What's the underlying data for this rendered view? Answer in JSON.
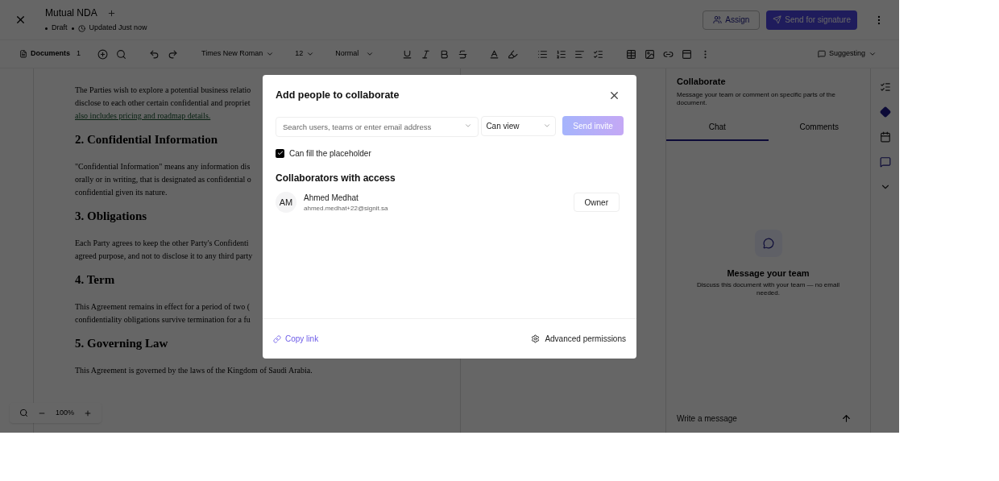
{
  "header": {
    "title": "Mutual NDA",
    "status": "Draft",
    "updated": "Updated Just now",
    "actions": [
      {
        "label": "Assign",
        "kind": "outline"
      },
      {
        "label": "Send for signature",
        "kind": "primary"
      }
    ]
  },
  "toolbar": {
    "documents": {
      "label": "Documents",
      "count": "1"
    },
    "font": "Times New Roman",
    "size": "12",
    "style": "Normal",
    "mode": "Suggesting"
  },
  "document": {
    "blocks": [
      {
        "kind": "paragraph",
        "lines": [
          {
            "text": "The Parties wish to explore a potential business relatio",
            "link": false
          },
          {
            "text": "disclose to each other certain confidential and propriet",
            "link": false
          },
          {
            "text": "also includes pricing and roadmap details.",
            "link": true
          }
        ]
      },
      {
        "kind": "heading",
        "text": "2. Confidential Information"
      },
      {
        "kind": "paragraph",
        "lines": [
          {
            "text": "\"Confidential Information\" means any information dis",
            "link": false
          },
          {
            "text": "orally or in writing, that is designated as confidential o",
            "link": false
          },
          {
            "text": "confidential given its nature.",
            "link": false
          }
        ]
      },
      {
        "kind": "heading",
        "text": "3. Obligations"
      },
      {
        "kind": "paragraph",
        "lines": [
          {
            "text": "Each Party agrees to keep the other Party's Confidenti",
            "link": false
          },
          {
            "text": "agreed purpose, and not to disclose it to any third party",
            "link": false
          }
        ]
      },
      {
        "kind": "heading",
        "text": "4. Term"
      },
      {
        "kind": "paragraph",
        "lines": [
          {
            "text": "This Agreement remains in effect for a period of two (",
            "link": false
          },
          {
            "text": "confidentiality obligations survive termination for a fu",
            "link": false
          }
        ]
      },
      {
        "kind": "heading",
        "text": "5. Governing Law"
      },
      {
        "kind": "paragraph",
        "lines": [
          {
            "text": "This Agreement is governed by the laws of the Kingdom of Saudi Arabia.",
            "link": false
          }
        ]
      }
    ]
  },
  "zoom": "100%",
  "panel": {
    "title": "Collaborate",
    "subtitle": "Message your team or comment on specific parts of the document.",
    "tabs": [
      {
        "label": "Chat",
        "selected": true
      },
      {
        "label": "Comments",
        "selected": false
      }
    ],
    "empty_title": "Message your team",
    "empty_text": "Discuss this document with your team — no email needed.",
    "composer_placeholder": "Write a message"
  },
  "modal": {
    "title": "Add people to collaborate",
    "search_placeholder": "Search users, teams or enter email address",
    "role": "Can view",
    "send": "Send invite",
    "checkbox": {
      "label": "Can fill the placeholder",
      "checked": true
    },
    "section": "Collaborators with access",
    "collaborators": [
      {
        "initials": "AM",
        "name": "Ahmed Medhat",
        "email": "ahmed.medhat+22@signit.sa",
        "role": "Owner"
      }
    ],
    "copy_link": "Copy link",
    "advanced": "Advanced permissions"
  }
}
